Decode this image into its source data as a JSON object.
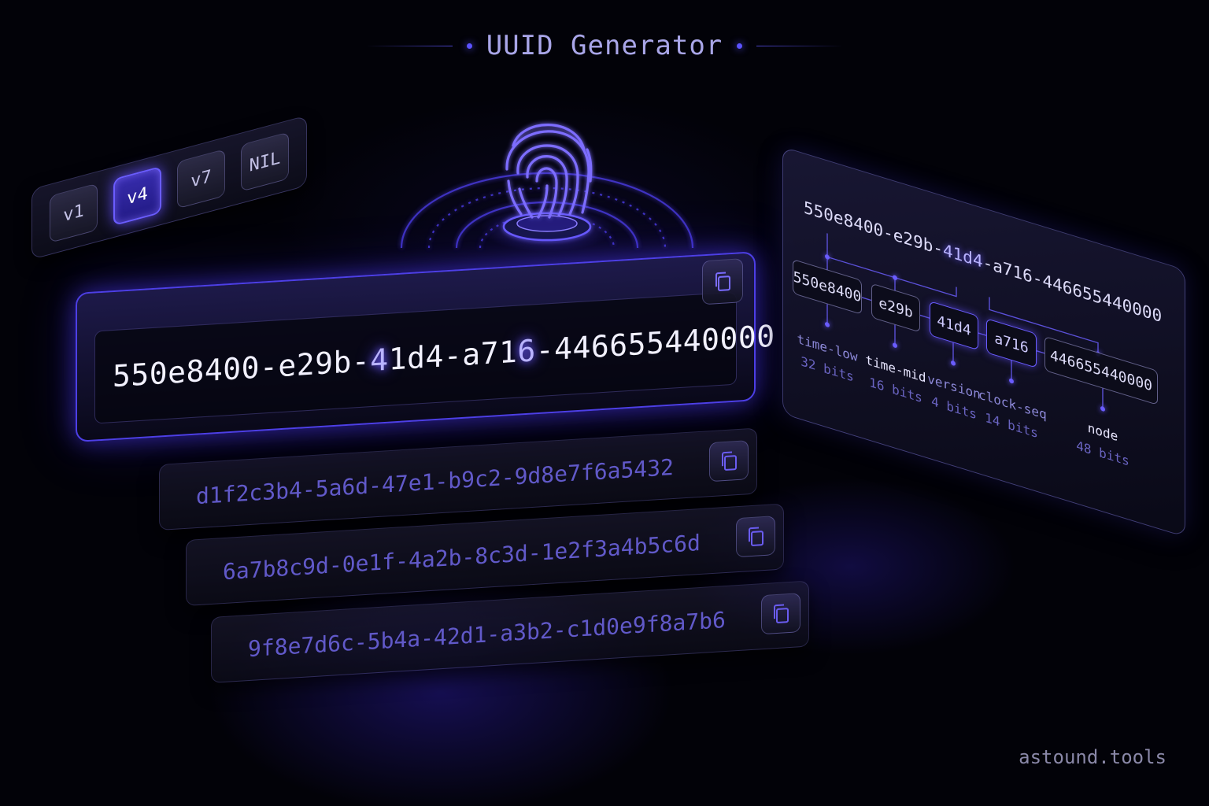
{
  "header": {
    "title": "UUID Generator"
  },
  "versions": {
    "tabs": [
      {
        "label": "v1",
        "active": false
      },
      {
        "label": "v4",
        "active": true
      },
      {
        "label": "v7",
        "active": false
      },
      {
        "label": "NIL",
        "active": false
      }
    ]
  },
  "main": {
    "uuid_parts": [
      "550e8400-e29b-",
      "4",
      "1d4-a71",
      "6",
      "-446655440000"
    ]
  },
  "history": [
    {
      "uuid": "d1f2c3b4-5a6d-47e1-b9c2-9d8e7f6a5432"
    },
    {
      "uuid": "6a7b8c9d-0e1f-4a2b-8c3d-1e2f3a4b5c6d"
    },
    {
      "uuid": "9f8e7d6c-5b4a-42d1-a3b2-c1d0e9f8a7b6"
    }
  ],
  "anatomy": {
    "uuid_parts": [
      "550e8400-e29b-",
      "41d4",
      "-a716-446655440000"
    ],
    "segments": [
      {
        "value": "550e8400",
        "name": "time-low",
        "bits": "32 bits"
      },
      {
        "value": "e29b",
        "name": "time-mid",
        "bits": "16 bits"
      },
      {
        "value": "41d4",
        "name": "version",
        "bits": "4 bits"
      },
      {
        "value": "a716",
        "name": "clock-seq",
        "bits": "14 bits"
      },
      {
        "value": "446655440000",
        "name": "node",
        "bits": "48 bits"
      }
    ]
  },
  "colors": {
    "accent": "#5b46ff",
    "background": "#020208"
  },
  "brand": "astound.tools",
  "icons": {
    "copy": "copy-icon",
    "fingerprint": "fingerprint-icon"
  }
}
